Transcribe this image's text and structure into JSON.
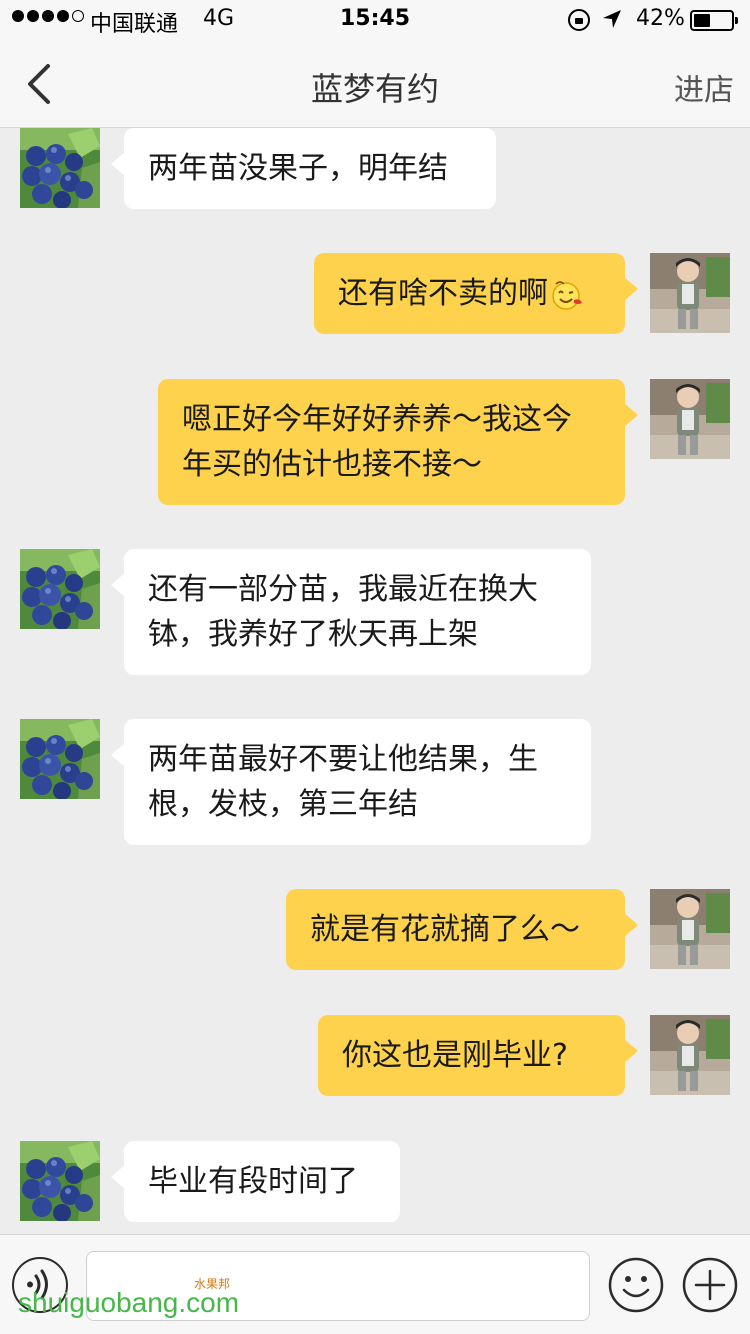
{
  "status_bar": {
    "carrier": "中国联通",
    "network": "4G",
    "time": "15:45",
    "battery": "42%"
  },
  "nav": {
    "title": "蓝梦有约",
    "action": "进店"
  },
  "messages": [
    {
      "from": "seller",
      "text": "两年苗没果子，明年结"
    },
    {
      "from": "me",
      "text": "还有啥不卖的啊",
      "emoji": "wink-face-icon"
    },
    {
      "from": "me",
      "lines": [
        "嗯正好今年好好养养～我这今",
        "年买的估计也接不接～"
      ]
    },
    {
      "from": "seller",
      "lines": [
        "还有一部分苗，我最近在换大",
        "钵，我养好了秋天再上架"
      ]
    },
    {
      "from": "seller",
      "lines": [
        "两年苗最好不要让他结果，生",
        "根，发枝，第三年结"
      ]
    },
    {
      "from": "me",
      "text": "就是有花就摘了么～"
    },
    {
      "from": "me",
      "text": "你这也是刚毕业?"
    },
    {
      "from": "seller",
      "text": "毕业有段时间了"
    }
  ],
  "input": {
    "placeholder": ""
  },
  "watermark": {
    "text": "shuiguobang.com",
    "brand": "水果邦"
  },
  "colors": {
    "outgoing_bubble": "#fed24d",
    "incoming_bubble": "#ffffff",
    "background": "#ededed"
  }
}
